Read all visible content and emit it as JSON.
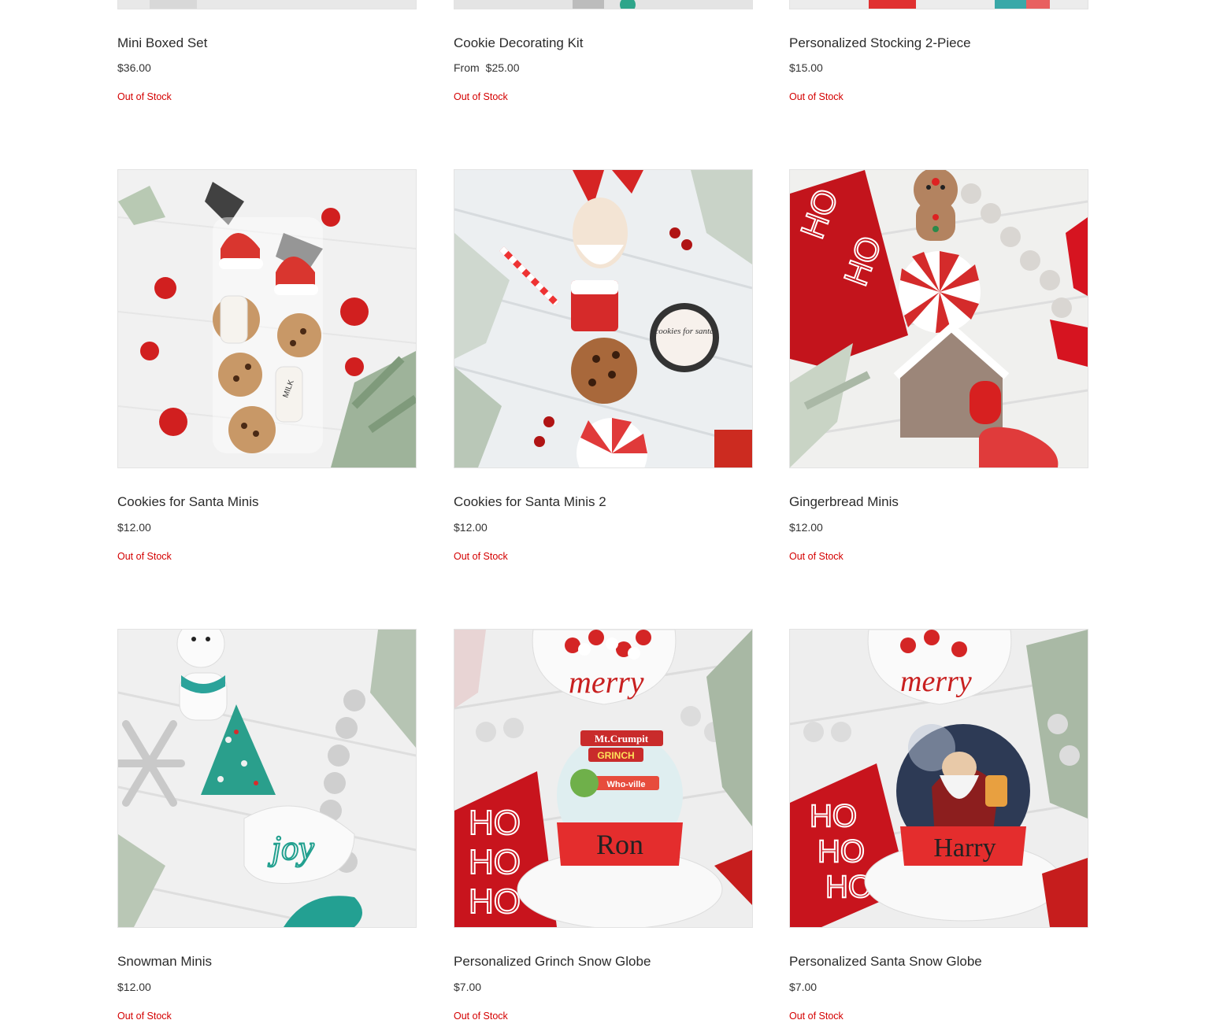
{
  "products": [
    {
      "title": "Mini Boxed Set",
      "price": "$36.00",
      "price_prefix": "",
      "stock": "Out of Stock"
    },
    {
      "title": "Cookie Decorating Kit",
      "price": "$25.00",
      "price_prefix": "From",
      "stock": "Out of Stock"
    },
    {
      "title": "Personalized Stocking 2-Piece",
      "price": "$15.00",
      "price_prefix": "",
      "stock": "Out of Stock"
    },
    {
      "title": "Cookies for Santa Minis",
      "price": "$12.00",
      "price_prefix": "",
      "stock": "Out of Stock"
    },
    {
      "title": "Cookies for Santa Minis 2",
      "price": "$12.00",
      "price_prefix": "",
      "stock": "Out of Stock"
    },
    {
      "title": "Gingerbread Minis",
      "price": "$12.00",
      "price_prefix": "",
      "stock": "Out of Stock"
    },
    {
      "title": "Snowman Minis",
      "price": "$12.00",
      "price_prefix": "",
      "stock": "Out of Stock"
    },
    {
      "title": "Personalized Grinch Snow Globe",
      "price": "$7.00",
      "price_prefix": "",
      "stock": "Out of Stock"
    },
    {
      "title": "Personalized Santa Snow Globe",
      "price": "$7.00",
      "price_prefix": "",
      "stock": "Out of Stock"
    }
  ],
  "images": {
    "santa_minis_milk": "MILK",
    "santa2_sign": "cookies for santa",
    "ho": "HO",
    "joy": "joy",
    "grinch_sign1": "Mt.Crumpit",
    "grinch_sign2": "GRINCH",
    "grinch_sign3": "Who-ville",
    "merry": "merry",
    "name_ron": "Ron",
    "name_harry": "Harry"
  }
}
